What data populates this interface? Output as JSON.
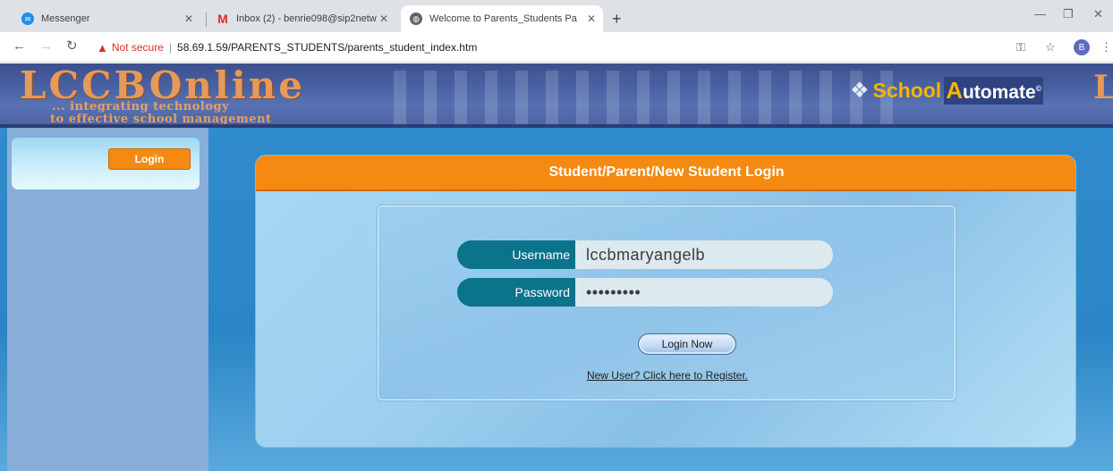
{
  "browser": {
    "tabs": [
      {
        "title": "Messenger",
        "icon": "messenger-icon",
        "active": false
      },
      {
        "title": "Inbox (2) - benrie098@sip2netw",
        "icon": "gmail-icon",
        "active": false
      },
      {
        "title": "Welcome to Parents_Students Pa",
        "icon": "globe-icon",
        "active": true
      }
    ],
    "new_tab": "+",
    "security_label": "Not secure",
    "url": "58.69.1.59/PARENTS_STUDENTS/parents_student_index.htm",
    "profile_initial": "B"
  },
  "banner": {
    "logo_main": "LCCB",
    "logo_online": "Online",
    "tagline_line1": "... integrating technology",
    "tagline_line2": "to effective school management",
    "partner_school": "School",
    "partner_a": "A",
    "partner_utomate": "utomate",
    "partner_trademark": "©",
    "edge_letter": "L"
  },
  "sidebar": {
    "login_label": "Login"
  },
  "login_panel": {
    "title": "Student/Parent/New Student Login",
    "username_label": "Username",
    "username_value": "lccbmaryangelb",
    "password_label": "Password",
    "password_value": "•••••••••",
    "submit_label": "Login Now",
    "register_link": "New User? Click here to Register."
  },
  "colors": {
    "accent_orange": "#f48a12",
    "field_label_teal": "#0b738a",
    "page_blue": "#1978b8"
  }
}
